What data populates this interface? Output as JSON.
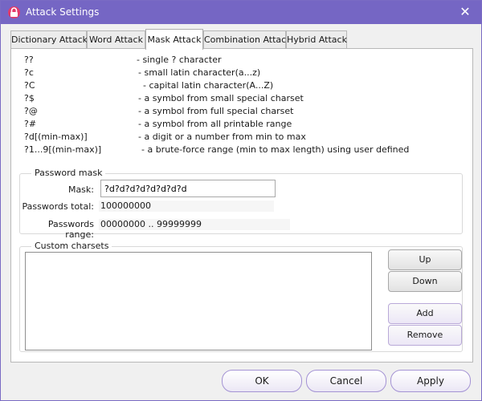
{
  "window": {
    "title": "Attack Settings"
  },
  "tabs": [
    {
      "label": "Dictionary Attack"
    },
    {
      "label": "Word Attack"
    },
    {
      "label": "Mask Attack"
    },
    {
      "label": "Combination Attack"
    },
    {
      "label": "Hybrid Attack"
    }
  ],
  "active_tab": "Mask Attack",
  "mask_reference": [
    {
      "symbol": "??",
      "description": "- single ? character"
    },
    {
      "symbol": "?c",
      "description": "- small latin character(a...z)"
    },
    {
      "symbol": "?C",
      "description": "- capital latin character(A...Z)"
    },
    {
      "symbol": "?$",
      "description": "- a symbol from small special charset"
    },
    {
      "symbol": "?@",
      "description": "- a symbol from full special charset"
    },
    {
      "symbol": "?#",
      "description": "- a symbol from all printable range"
    },
    {
      "symbol": "?d[(min-max)]",
      "description": "- a digit or a number from min to max"
    },
    {
      "symbol": "?1...9[(min-max)]",
      "description": "- a brute-force range (min to max length) using user defined"
    }
  ],
  "password_mask": {
    "legend": "Password mask",
    "mask_label": "Mask:",
    "mask_value": "?d?d?d?d?d?d?d?d",
    "total_label": "Passwords total:",
    "total_value": "100000000",
    "range_label": "Passwords range:",
    "range_value": "00000000  ..  99999999"
  },
  "custom_charsets": {
    "legend": "Custom charsets",
    "up_label": "Up",
    "down_label": "Down",
    "add_label": "Add",
    "remove_label": "Remove"
  },
  "footer": {
    "ok_label": "OK",
    "cancel_label": "Cancel",
    "apply_label": "Apply"
  },
  "colors": {
    "titlebar": "#7566c4",
    "accent": "#a493d4"
  },
  "icons": {
    "app": "key-lock-icon",
    "close": "close-icon"
  }
}
